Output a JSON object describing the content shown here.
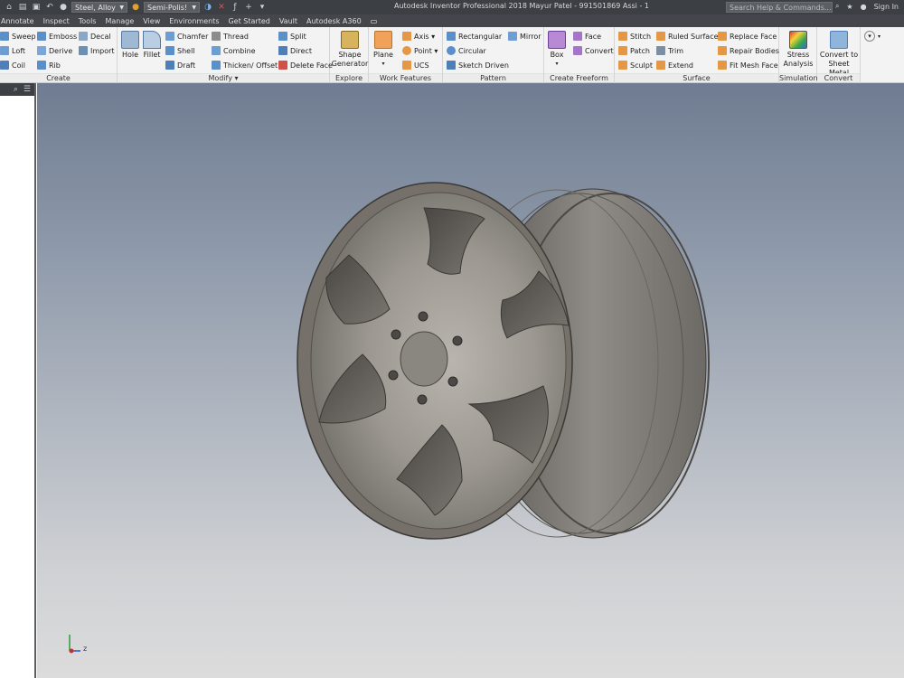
{
  "titlebar": {
    "material": "Steel, Alloy",
    "appearance": "Semi-Polis!",
    "app_title": "Autodesk Inventor Professional 2018   Mayur Patel - 991501869 Assi - 1",
    "search_placeholder": "Search Help & Commands...",
    "sign_in": "Sign In"
  },
  "menu": {
    "tabs": [
      "Annotate",
      "Inspect",
      "Tools",
      "Manage",
      "View",
      "Environments",
      "Get Started",
      "Vault",
      "Autodesk A360"
    ]
  },
  "ribbon": {
    "create": {
      "label": "Create",
      "sweep": "Sweep",
      "loft": "Loft",
      "coil": "Coil",
      "emboss": "Emboss",
      "derive": "Derive",
      "rib": "Rib",
      "decal": "Decal",
      "import": "Import"
    },
    "modify": {
      "label": "Modify ▾",
      "hole": "Hole",
      "fillet": "Fillet",
      "chamfer": "Chamfer",
      "shell": "Shell",
      "draft": "Draft",
      "thread": "Thread",
      "combine": "Combine",
      "thicken": "Thicken/ Offset",
      "split": "Split",
      "direct": "Direct",
      "delete_face": "Delete Face"
    },
    "explore": {
      "label": "Explore",
      "shape_gen_1": "Shape",
      "shape_gen_2": "Generator"
    },
    "work_features": {
      "label": "Work Features",
      "plane": "Plane",
      "axis": "Axis ▾",
      "point": "Point ▾",
      "ucs": "UCS"
    },
    "pattern": {
      "label": "Pattern",
      "rectangular": "Rectangular",
      "circular": "Circular",
      "sketch_driven": "Sketch Driven",
      "mirror": "Mirror"
    },
    "freeform": {
      "label": "Create Freeform",
      "box": "Box",
      "face": "Face",
      "convert": "Convert"
    },
    "surface": {
      "label": "Surface",
      "stitch": "Stitch",
      "patch": "Patch",
      "sculpt": "Sculpt",
      "ruled": "Ruled Surface",
      "trim": "Trim",
      "extend": "Extend",
      "replace_face": "Replace Face",
      "repair_bodies": "Repair Bodies",
      "fit_mesh_face": "Fit Mesh Face"
    },
    "simulation": {
      "label": "Simulation",
      "stress_1": "Stress",
      "stress_2": "Analysis"
    },
    "convert": {
      "label": "Convert",
      "sheet_1": "Convert to",
      "sheet_2": "Sheet Metal"
    }
  },
  "viewport": {
    "axis_z_label": "z"
  },
  "colors": {
    "titlebar": "#3c3f44",
    "ribbon": "#f3f3f3",
    "viewport_top": "#6f7c91",
    "viewport_bottom": "#dcdcdc",
    "wheel": "#7e7a74"
  }
}
